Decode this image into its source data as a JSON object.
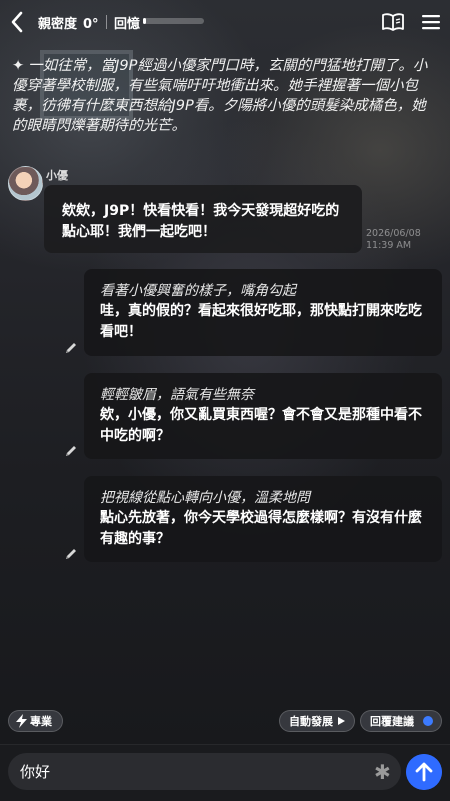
{
  "header": {
    "intimacy_label": "親密度",
    "intimacy_value": "0°",
    "memory_label": "回憶",
    "memory_progress": 0.04
  },
  "narration": {
    "symbol": "✦",
    "text": "一如往常，當J9P經過小優家門口時，玄關的門猛地打開了。小優穿著學校制服，有些氣喘吁吁地衝出來。她手裡握著一個小包裹，彷彿有什麼東西想給J9P看。夕陽將小優的頭髮染成橘色，她的眼睛閃爍著期待的光芒。"
  },
  "character": {
    "name": "小優",
    "message": "欸欸，J9P！快看快看！我今天發現超好吃的點心耶！我們一起吃吧！",
    "date": "2026/06/08",
    "time": "11:39 AM"
  },
  "options": [
    {
      "action": "看著小優興奮的樣子，嘴角勾起",
      "speech": "哇，真的假的？看起來很好吃耶，那快點打開來吃吃看吧！"
    },
    {
      "action": "輕輕皺眉，語氣有些無奈",
      "speech": "欸，小優，你又亂買東西喔？會不會又是那種中看不中吃的啊？"
    },
    {
      "action": "把視線從點心轉向小優，溫柔地問",
      "speech": "點心先放著，你今天學校過得怎麼樣啊？有沒有什麼有趣的事？"
    }
  ],
  "controls": {
    "pro_label": "專業",
    "auto_label": "自動發展",
    "suggest_label": "回覆建議",
    "suggest_on": true
  },
  "input": {
    "value": "你好"
  },
  "colors": {
    "accent": "#2f6bff",
    "toggle": "#3c7bff"
  }
}
